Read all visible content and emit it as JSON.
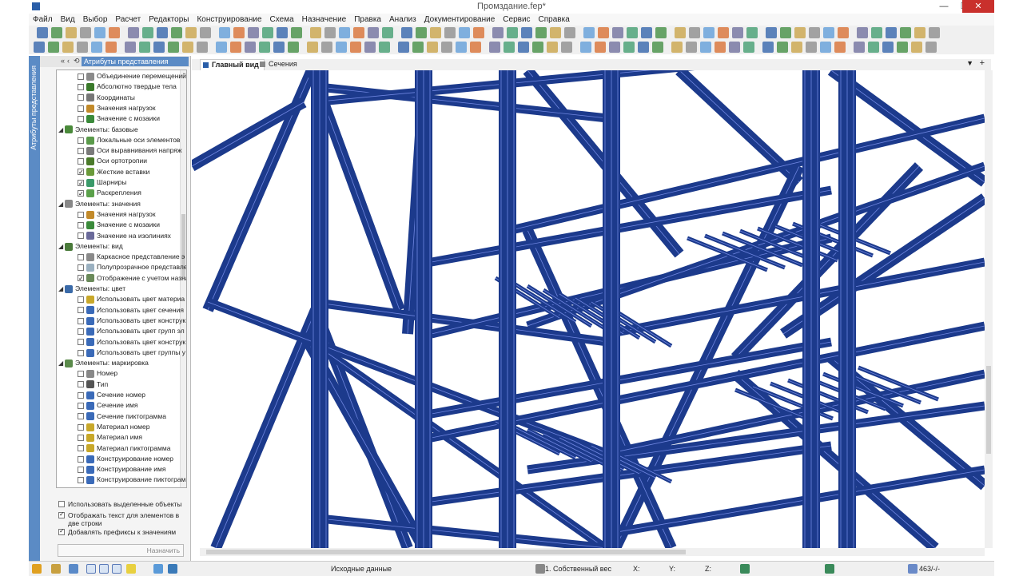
{
  "window": {
    "title": "Промздание.fep*",
    "controls": [
      "—",
      "❐",
      "✕"
    ]
  },
  "menu": [
    "Файл",
    "Вид",
    "Выбор",
    "Расчет",
    "Редакторы",
    "Конструирование",
    "Схема",
    "Назначение",
    "Правка",
    "Анализ",
    "Документирование",
    "Сервис",
    "Справка"
  ],
  "sidebar": {
    "vertical_label": "Атрибуты представления",
    "panel_title": "Атрибуты представления",
    "nav": [
      "«",
      "‹",
      "⟲"
    ]
  },
  "tree": [
    {
      "label": "Объединение перемещений",
      "type": "item",
      "checked": false,
      "icon": "#8a8a8a"
    },
    {
      "label": "Абсолютно твердые тела",
      "type": "item",
      "checked": false,
      "icon": "#3a7a2a"
    },
    {
      "label": "Координаты",
      "type": "item",
      "checked": false,
      "icon": "#777777"
    },
    {
      "label": "Значения нагрузок",
      "type": "item",
      "checked": false,
      "icon": "#c28a2a"
    },
    {
      "label": "Значение с мозаики",
      "type": "item",
      "checked": false,
      "icon": "#3a8a3a"
    },
    {
      "label": "Элементы: базовые",
      "type": "group",
      "icon": "#4a8a3a"
    },
    {
      "label": "Локальные оси элементов",
      "type": "item",
      "checked": false,
      "icon": "#5a9a4a"
    },
    {
      "label": "Оси выравнивания напряж",
      "type": "item",
      "checked": false,
      "icon": "#7a7a7a"
    },
    {
      "label": "Оси ортотропии",
      "type": "item",
      "checked": false,
      "icon": "#4a7a2a"
    },
    {
      "label": "Жесткие вставки",
      "type": "item",
      "checked": true,
      "icon": "#6a9a3a"
    },
    {
      "label": "Шарниры",
      "type": "item",
      "checked": true,
      "icon": "#3a9a6a"
    },
    {
      "label": "Раскрепления",
      "type": "item",
      "checked": true,
      "icon": "#5aa04a"
    },
    {
      "label": "Элементы: значения",
      "type": "group",
      "icon": "#888888"
    },
    {
      "label": "Значения нагрузок",
      "type": "item",
      "checked": false,
      "icon": "#c28a2a"
    },
    {
      "label": "Значение с мозаики",
      "type": "item",
      "checked": false,
      "icon": "#3a8a3a"
    },
    {
      "label": "Значение на изолиниях",
      "type": "item",
      "checked": false,
      "icon": "#6a6a9a"
    },
    {
      "label": "Элементы: вид",
      "type": "group",
      "icon": "#4a7a3a"
    },
    {
      "label": "Каркасное представление э",
      "type": "item",
      "checked": false,
      "icon": "#8a8a8a"
    },
    {
      "label": "Полупрозрачное представле",
      "type": "item",
      "checked": false,
      "icon": "#9ab0c0"
    },
    {
      "label": "Отображение с учетом назна",
      "type": "item",
      "checked": true,
      "icon": "#6a8a5a"
    },
    {
      "label": "Элементы: цвет",
      "type": "group",
      "icon": "#3a6aa8"
    },
    {
      "label": "Использовать цвет материа",
      "type": "item",
      "checked": false,
      "icon": "#c8a82a"
    },
    {
      "label": "Использовать цвет сечения",
      "type": "item",
      "checked": false,
      "icon": "#3a6ab8"
    },
    {
      "label": "Использовать цвет конструк",
      "type": "item",
      "checked": false,
      "icon": "#3a6ab8"
    },
    {
      "label": "Использовать цвет групп эл",
      "type": "item",
      "checked": false,
      "icon": "#3a6ab8"
    },
    {
      "label": "Использовать цвет конструк",
      "type": "item",
      "checked": false,
      "icon": "#3a6ab8"
    },
    {
      "label": "Использовать цвет группы у",
      "type": "item",
      "checked": false,
      "icon": "#3a6ab8"
    },
    {
      "label": "Элементы: маркировка",
      "type": "group",
      "icon": "#5a8a4a"
    },
    {
      "label": "Номер",
      "type": "item",
      "checked": false,
      "icon": "#888888"
    },
    {
      "label": "Тип",
      "type": "item",
      "checked": false,
      "icon": "#555555"
    },
    {
      "label": "Сечение номер",
      "type": "item",
      "checked": false,
      "icon": "#3a6ab8"
    },
    {
      "label": "Сечение имя",
      "type": "item",
      "checked": false,
      "icon": "#3a6ab8"
    },
    {
      "label": "Сечение пиктограмма",
      "type": "item",
      "checked": false,
      "icon": "#3a6ab8"
    },
    {
      "label": "Материал номер",
      "type": "item",
      "checked": false,
      "icon": "#c8a82a"
    },
    {
      "label": "Материал имя",
      "type": "item",
      "checked": false,
      "icon": "#c8a82a"
    },
    {
      "label": "Материал пиктограмма",
      "type": "item",
      "checked": false,
      "icon": "#c8a82a"
    },
    {
      "label": "Конструирование номер",
      "type": "item",
      "checked": false,
      "icon": "#3a6ab8"
    },
    {
      "label": "Конструирование имя",
      "type": "item",
      "checked": false,
      "icon": "#3a6ab8"
    },
    {
      "label": "Конструирование пиктограм",
      "type": "item",
      "checked": false,
      "icon": "#3a6ab8"
    }
  ],
  "options": [
    {
      "label": "Использовать выделенные объекты",
      "checked": false
    },
    {
      "label": "Отображать текст для элементов в две строки",
      "checked": true
    },
    {
      "label": "Добавлять префиксы к значениям",
      "checked": true
    }
  ],
  "assign_button": "Назначить",
  "tabs": [
    {
      "label": "Главный вид",
      "active": true
    },
    {
      "label": "Сечения",
      "active": false
    }
  ],
  "status": {
    "mode": "Исходные данные",
    "load_case": "1. Собственный вес",
    "x_label": "X:",
    "y_label": "Y:",
    "z_label": "Z:",
    "count": "463/-/-"
  },
  "colors": {
    "accent": "#5b8bc5",
    "steel": "#1c3a8c",
    "steel_highlight": "#6f86e0"
  }
}
